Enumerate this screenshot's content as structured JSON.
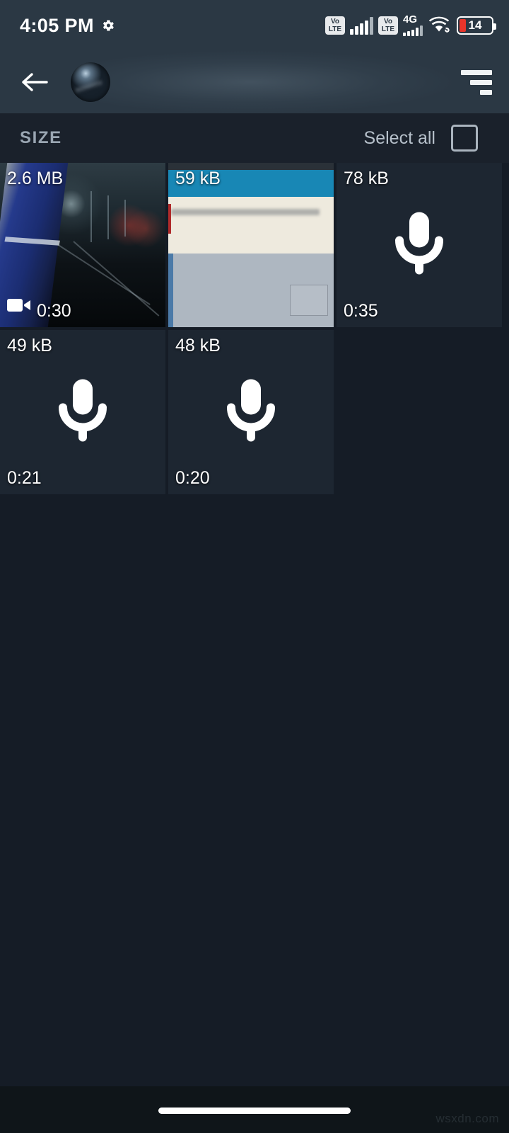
{
  "status_bar": {
    "time": "4:05 PM",
    "gear_icon": "gear-icon",
    "sim1_volte": "VoLTE",
    "sim1_volte_line1": "Vo",
    "sim1_volte_line2": "LTE",
    "sim2_volte_line1": "Vo",
    "sim2_volte_line2": "LTE",
    "network_type": "4G",
    "wifi_icon": "wifi-icon",
    "battery_percent": "14"
  },
  "toolbar": {
    "back_icon": "back-arrow-icon",
    "avatar": "contact-avatar",
    "title": "",
    "subtitle": "",
    "sort_icon": "sort-icon"
  },
  "section": {
    "title": "SIZE",
    "select_all_label": "Select all",
    "checkbox_checked": false,
    "highlight_color": "#ec1c24"
  },
  "media": {
    "items": [
      {
        "size": "2.6 MB",
        "duration": "0:30",
        "type": "video",
        "thumb": "night-train-video"
      },
      {
        "size": "59 kB",
        "duration": "",
        "type": "image",
        "thumb": "screenshot-image"
      },
      {
        "size": "78 kB",
        "duration": "0:35",
        "type": "audio",
        "thumb": "microphone-icon"
      },
      {
        "size": "49 kB",
        "duration": "0:21",
        "type": "audio",
        "thumb": "microphone-icon"
      },
      {
        "size": "48 kB",
        "duration": "0:20",
        "type": "audio",
        "thumb": "microphone-icon"
      }
    ]
  },
  "nav_bar": {
    "gesture_pill": "home-gesture-pill"
  },
  "watermark": {
    "text": "wsxdn.com"
  },
  "colors": {
    "page_bg": "#151c26",
    "toolbar_bg": "#2b3844",
    "tile_bg": "#1d2631",
    "section_bg": "#1a212b",
    "accent_red": "#ec1c24",
    "battery_red": "#e8352b"
  }
}
